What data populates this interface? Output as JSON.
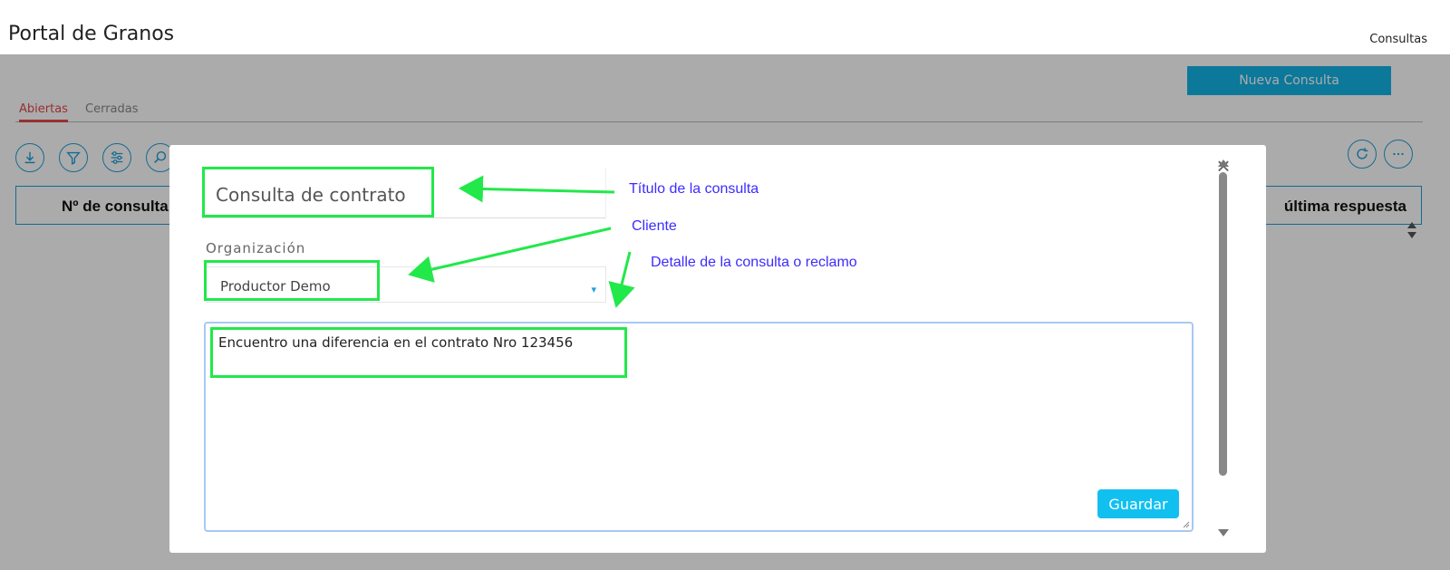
{
  "header": {
    "title": "Portal de Granos",
    "nav_link": "Consultas"
  },
  "toolbar": {
    "new_button": "Nueva Consulta"
  },
  "tabs": [
    {
      "label": "Abiertas",
      "active": true
    },
    {
      "label": "Cerradas",
      "active": false
    }
  ],
  "table": {
    "col_first": "Nº de consulta",
    "col_last": "última respuesta"
  },
  "modal": {
    "title_value": "Consulta de contrato",
    "org_label": "Organización",
    "org_value": "Productor Demo",
    "detail_value": "Encuentro una diferencia en el contrato Nro 123456",
    "save_button": "Guardar",
    "close_symbol": "×"
  },
  "annotations": {
    "title_note": "Título de la consulta",
    "client_note": "Cliente",
    "detail_note": "Detalle de la consulta o reclamo",
    "highlight_color": "#22e84a",
    "note_color": "#3d2bff"
  }
}
